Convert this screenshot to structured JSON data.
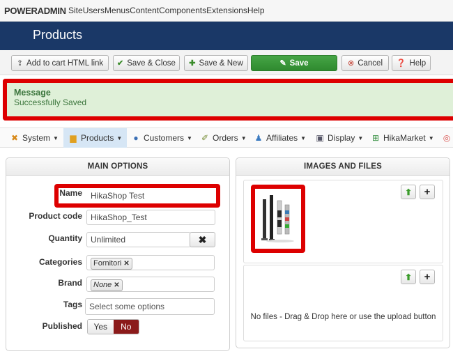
{
  "topbar": {
    "logo": "POWERADMIN",
    "menu": [
      "Site",
      "Users",
      "Menus",
      "Content",
      "Components",
      "Extensions",
      "Help"
    ]
  },
  "page": {
    "title": "Products"
  },
  "toolbar": {
    "add_to_cart": "Add to cart HTML link",
    "save_close": "Save & Close",
    "save_new": "Save & New",
    "save": "Save",
    "cancel": "Cancel",
    "help": "Help"
  },
  "message": {
    "heading": "Message",
    "text": "Successfully Saved"
  },
  "hikamenu": {
    "items": [
      "System",
      "Products",
      "Customers",
      "Orders",
      "Affiliates",
      "Display",
      "HikaMarket"
    ]
  },
  "main_options": {
    "header": "MAIN OPTIONS",
    "name_label": "Name",
    "name_value": "HikaShop Test",
    "code_label": "Product code",
    "code_value": "HikaShop_Test",
    "quantity_label": "Quantity",
    "quantity_value": "Unlimited",
    "categories_label": "Categories",
    "categories_tag": "Fornitori",
    "brand_label": "Brand",
    "brand_tag": "None",
    "tags_label": "Tags",
    "tags_placeholder": "Select some options",
    "published_label": "Published",
    "published_yes": "Yes",
    "published_no": "No"
  },
  "images_files": {
    "header": "IMAGES AND FILES",
    "no_files": "No files - Drag & Drop here or use the upload button"
  },
  "colors": {
    "title_bar": "#1a3867",
    "save_green": "#3a993a",
    "message_bg": "#dff0d8",
    "highlight_red": "#dd0000",
    "published_no": "#8b1a1a"
  }
}
